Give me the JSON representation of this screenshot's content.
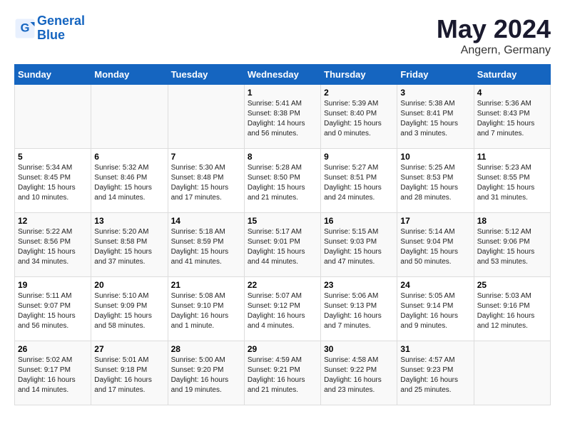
{
  "logo": {
    "line1": "General",
    "line2": "Blue"
  },
  "title": "May 2024",
  "subtitle": "Angern, Germany",
  "days_of_week": [
    "Sunday",
    "Monday",
    "Tuesday",
    "Wednesday",
    "Thursday",
    "Friday",
    "Saturday"
  ],
  "weeks": [
    [
      {
        "day": "",
        "info": ""
      },
      {
        "day": "",
        "info": ""
      },
      {
        "day": "",
        "info": ""
      },
      {
        "day": "1",
        "info": "Sunrise: 5:41 AM\nSunset: 8:38 PM\nDaylight: 14 hours\nand 56 minutes."
      },
      {
        "day": "2",
        "info": "Sunrise: 5:39 AM\nSunset: 8:40 PM\nDaylight: 15 hours\nand 0 minutes."
      },
      {
        "day": "3",
        "info": "Sunrise: 5:38 AM\nSunset: 8:41 PM\nDaylight: 15 hours\nand 3 minutes."
      },
      {
        "day": "4",
        "info": "Sunrise: 5:36 AM\nSunset: 8:43 PM\nDaylight: 15 hours\nand 7 minutes."
      }
    ],
    [
      {
        "day": "5",
        "info": "Sunrise: 5:34 AM\nSunset: 8:45 PM\nDaylight: 15 hours\nand 10 minutes."
      },
      {
        "day": "6",
        "info": "Sunrise: 5:32 AM\nSunset: 8:46 PM\nDaylight: 15 hours\nand 14 minutes."
      },
      {
        "day": "7",
        "info": "Sunrise: 5:30 AM\nSunset: 8:48 PM\nDaylight: 15 hours\nand 17 minutes."
      },
      {
        "day": "8",
        "info": "Sunrise: 5:28 AM\nSunset: 8:50 PM\nDaylight: 15 hours\nand 21 minutes."
      },
      {
        "day": "9",
        "info": "Sunrise: 5:27 AM\nSunset: 8:51 PM\nDaylight: 15 hours\nand 24 minutes."
      },
      {
        "day": "10",
        "info": "Sunrise: 5:25 AM\nSunset: 8:53 PM\nDaylight: 15 hours\nand 28 minutes."
      },
      {
        "day": "11",
        "info": "Sunrise: 5:23 AM\nSunset: 8:55 PM\nDaylight: 15 hours\nand 31 minutes."
      }
    ],
    [
      {
        "day": "12",
        "info": "Sunrise: 5:22 AM\nSunset: 8:56 PM\nDaylight: 15 hours\nand 34 minutes."
      },
      {
        "day": "13",
        "info": "Sunrise: 5:20 AM\nSunset: 8:58 PM\nDaylight: 15 hours\nand 37 minutes."
      },
      {
        "day": "14",
        "info": "Sunrise: 5:18 AM\nSunset: 8:59 PM\nDaylight: 15 hours\nand 41 minutes."
      },
      {
        "day": "15",
        "info": "Sunrise: 5:17 AM\nSunset: 9:01 PM\nDaylight: 15 hours\nand 44 minutes."
      },
      {
        "day": "16",
        "info": "Sunrise: 5:15 AM\nSunset: 9:03 PM\nDaylight: 15 hours\nand 47 minutes."
      },
      {
        "day": "17",
        "info": "Sunrise: 5:14 AM\nSunset: 9:04 PM\nDaylight: 15 hours\nand 50 minutes."
      },
      {
        "day": "18",
        "info": "Sunrise: 5:12 AM\nSunset: 9:06 PM\nDaylight: 15 hours\nand 53 minutes."
      }
    ],
    [
      {
        "day": "19",
        "info": "Sunrise: 5:11 AM\nSunset: 9:07 PM\nDaylight: 15 hours\nand 56 minutes."
      },
      {
        "day": "20",
        "info": "Sunrise: 5:10 AM\nSunset: 9:09 PM\nDaylight: 15 hours\nand 58 minutes."
      },
      {
        "day": "21",
        "info": "Sunrise: 5:08 AM\nSunset: 9:10 PM\nDaylight: 16 hours\nand 1 minute."
      },
      {
        "day": "22",
        "info": "Sunrise: 5:07 AM\nSunset: 9:12 PM\nDaylight: 16 hours\nand 4 minutes."
      },
      {
        "day": "23",
        "info": "Sunrise: 5:06 AM\nSunset: 9:13 PM\nDaylight: 16 hours\nand 7 minutes."
      },
      {
        "day": "24",
        "info": "Sunrise: 5:05 AM\nSunset: 9:14 PM\nDaylight: 16 hours\nand 9 minutes."
      },
      {
        "day": "25",
        "info": "Sunrise: 5:03 AM\nSunset: 9:16 PM\nDaylight: 16 hours\nand 12 minutes."
      }
    ],
    [
      {
        "day": "26",
        "info": "Sunrise: 5:02 AM\nSunset: 9:17 PM\nDaylight: 16 hours\nand 14 minutes."
      },
      {
        "day": "27",
        "info": "Sunrise: 5:01 AM\nSunset: 9:18 PM\nDaylight: 16 hours\nand 17 minutes."
      },
      {
        "day": "28",
        "info": "Sunrise: 5:00 AM\nSunset: 9:20 PM\nDaylight: 16 hours\nand 19 minutes."
      },
      {
        "day": "29",
        "info": "Sunrise: 4:59 AM\nSunset: 9:21 PM\nDaylight: 16 hours\nand 21 minutes."
      },
      {
        "day": "30",
        "info": "Sunrise: 4:58 AM\nSunset: 9:22 PM\nDaylight: 16 hours\nand 23 minutes."
      },
      {
        "day": "31",
        "info": "Sunrise: 4:57 AM\nSunset: 9:23 PM\nDaylight: 16 hours\nand 25 minutes."
      },
      {
        "day": "",
        "info": ""
      }
    ]
  ]
}
